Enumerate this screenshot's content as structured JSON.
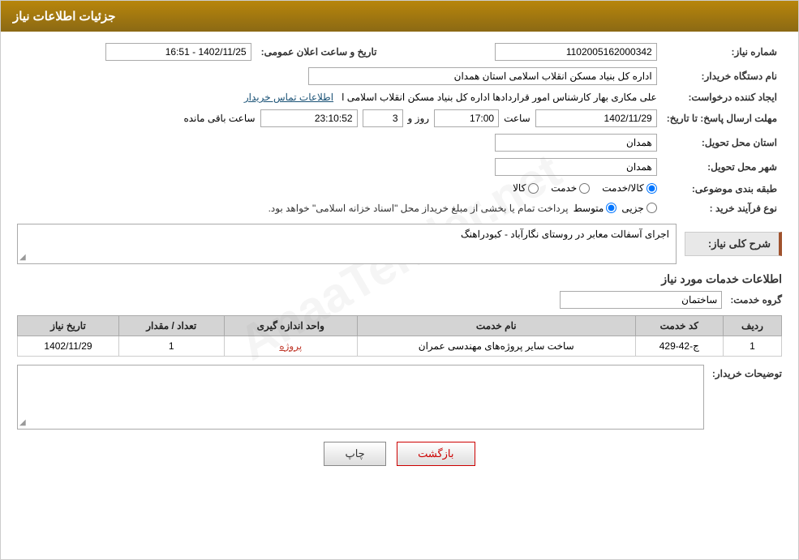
{
  "header": {
    "title": "جزئیات اطلاعات نیاز"
  },
  "fields": {
    "shomare_niaz_label": "شماره نیاز:",
    "shomare_niaz_value": "1102005162000342",
    "nam_dastgah_label": "نام دستگاه خریدار:",
    "nam_dastgah_value": "اداره کل بنیاد مسکن انقلاب اسلامی استان همدان",
    "ijad_konande_label": "ایجاد کننده درخواست:",
    "ijad_konande_value": "علی مکاری بهار کارشناس امور قراردادها اداره کل بنیاد مسکن انقلاب اسلامی ا",
    "ijad_konande_link": "اطلاعات تماس خریدار",
    "mohlat_label": "مهلت ارسال پاسخ: تا تاریخ:",
    "mohlat_date": "1402/11/29",
    "mohlat_time_label": "ساعت",
    "mohlat_time": "17:00",
    "mohlat_day_label": "روز و",
    "mohlat_day": "3",
    "mohlat_remain_label": "ساعت باقی مانده",
    "mohlat_remain": "23:10:52",
    "ostan_tahvil_label": "استان محل تحویل:",
    "ostan_tahvil_value": "همدان",
    "shahr_tahvil_label": "شهر محل تحویل:",
    "shahr_tahvil_value": "همدان",
    "tabaqeh_label": "طبقه بندی موضوعی:",
    "tabaqeh_options": [
      "کالا",
      "خدمت",
      "کالا/خدمت"
    ],
    "tabaqeh_selected": "کالا",
    "nogh_farayand_label": "نوع فرآیند خرید :",
    "nogh_farayand_options": [
      "جزیی",
      "متوسط"
    ],
    "nogh_farayand_text": "پرداخت تمام یا بخشی از مبلغ خریداز محل \"اسناد خزانه اسلامی\" خواهد بود.",
    "tarikh_aalan_label": "تاریخ و ساعت اعلان عمومی:",
    "tarikh_aalan_value": "1402/11/25 - 16:51"
  },
  "sharh": {
    "section_title": "شرح کلی نیاز:",
    "value": "اجرای آسفالت معابر در روستای نگارآباد - کبودراهنگ"
  },
  "services": {
    "section_title": "اطلاعات خدمات مورد نیاز",
    "group_label": "گروه خدمت:",
    "group_value": "ساختمان",
    "table": {
      "headers": [
        "ردیف",
        "کد خدمت",
        "نام خدمت",
        "واحد اندازه گیری",
        "تعداد / مقدار",
        "تاریخ نیاز"
      ],
      "rows": [
        {
          "radif": "1",
          "kod": "ج-42-429",
          "name": "ساخت سایر پروژه‌های مهندسی عمران",
          "vahed": "پروژه",
          "tedad": "1",
          "tarikh": "1402/11/29"
        }
      ]
    }
  },
  "tozihat": {
    "label": "توضیحات خریدار:",
    "value": ""
  },
  "buttons": {
    "print": "چاپ",
    "back": "بازگشت"
  }
}
